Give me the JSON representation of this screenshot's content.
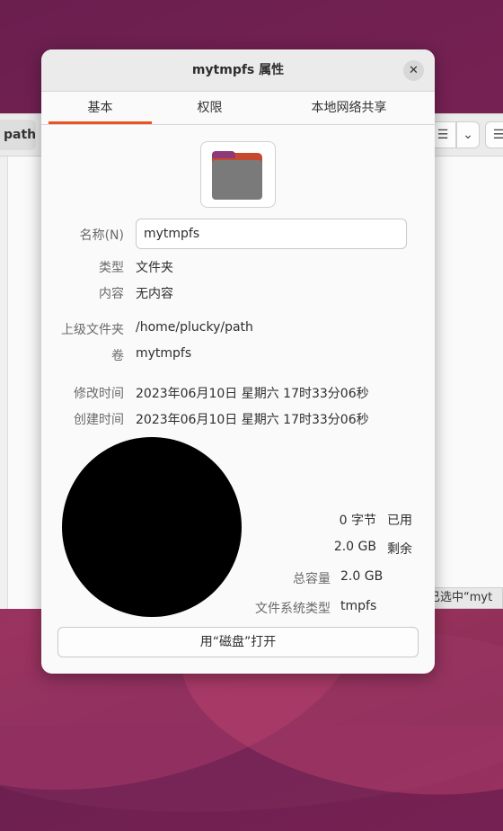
{
  "background_window": {
    "path_segment": "path",
    "status_text": "已选中“myt"
  },
  "dialog": {
    "title": "mytmpfs 属性",
    "tabs": [
      {
        "label": "基本",
        "active": true
      },
      {
        "label": "权限",
        "active": false
      },
      {
        "label": "本地网络共享",
        "active": false
      }
    ],
    "folder_icon": "folder-icon",
    "name": {
      "label": "名称(N)",
      "value": "mytmpfs"
    },
    "type": {
      "label": "类型",
      "value": "文件夹"
    },
    "contents": {
      "label": "内容",
      "value": "无内容"
    },
    "parent": {
      "label": "上级文件夹",
      "value": "/home/plucky/path"
    },
    "volume": {
      "label": "卷",
      "value": "mytmpfs"
    },
    "modified": {
      "label": "修改时间",
      "value": "2023年06月10日 星期六 17时33分06秒"
    },
    "created": {
      "label": "创建时间",
      "value": "2023年06月10日 星期六 17时33分06秒"
    },
    "usage": {
      "used_value": "0 字节",
      "used_label": "已用",
      "free_value": "2.0 GB",
      "free_label": "剩余",
      "total_label": "总容量",
      "total_value": "2.0 GB",
      "fs_label": "文件系统类型",
      "fs_value": "tmpfs",
      "used_fraction": 0
    },
    "open_button": "用“磁盘”打开",
    "accent_color": "#e95420"
  }
}
